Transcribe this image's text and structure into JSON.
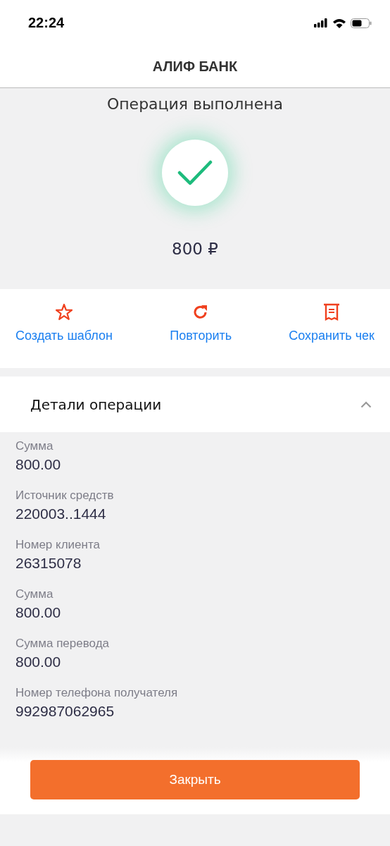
{
  "status_bar": {
    "time": "22:24"
  },
  "header": {
    "title": "АЛИФ БАНК"
  },
  "result": {
    "title": "Операция выполнена",
    "amount": "800 ₽"
  },
  "actions": [
    {
      "kind": "star",
      "label": "Создать шаблон"
    },
    {
      "kind": "repeat",
      "label": "Повторить"
    },
    {
      "kind": "receipt",
      "label": "Сохранить чек"
    }
  ],
  "details": {
    "title": "Детали операции",
    "expanded": true,
    "fields": [
      {
        "label": "Сумма",
        "value": "800.00"
      },
      {
        "label": "Источник средств",
        "value": "220003..1444"
      },
      {
        "label": "Номер клиента",
        "value": "26315078"
      },
      {
        "label": "Сумма",
        "value": "800.00"
      },
      {
        "label": "Сумма перевода",
        "value": "800.00"
      },
      {
        "label": "Номер телефона получателя",
        "value": "992987062965"
      }
    ]
  },
  "close_button": {
    "label": "Закрыть"
  }
}
